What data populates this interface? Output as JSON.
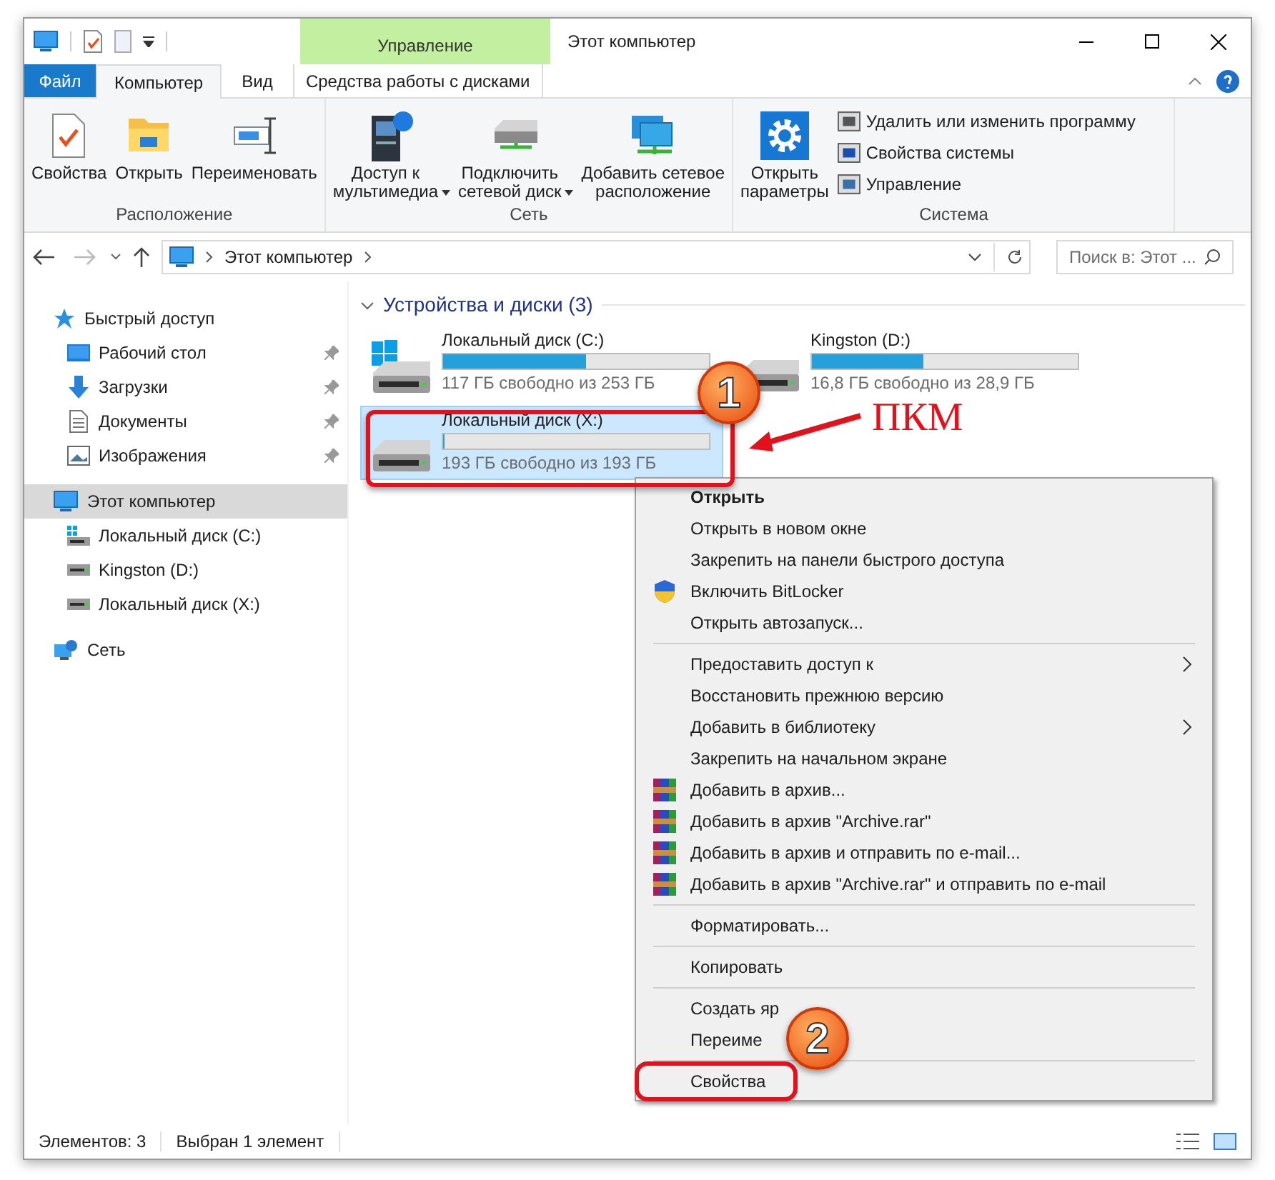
{
  "title_bar": {
    "context_tab": "Управление",
    "title": "Этот компьютер"
  },
  "ribbon_tabs": [
    {
      "label": "Файл",
      "kind": "file",
      "selected": false
    },
    {
      "label": "Компьютер",
      "kind": "tab",
      "selected": true
    },
    {
      "label": "Вид",
      "kind": "tab",
      "selected": false
    },
    {
      "label": "Средства работы с дисками",
      "kind": "context",
      "selected": false
    }
  ],
  "ribbon_groups": [
    {
      "label": "Расположение",
      "buttons": [
        {
          "label": "Свойства"
        },
        {
          "label": "Открыть"
        },
        {
          "label": "Переименовать"
        }
      ]
    },
    {
      "label": "Сеть",
      "buttons": [
        {
          "label": "Доступ к\nмультимедиа",
          "dropdown": true
        },
        {
          "label": "Подключить\nсетевой диск",
          "dropdown": true
        },
        {
          "label": "Добавить сетевое\nрасположение",
          "dropdown": false
        }
      ]
    },
    {
      "label": "Система",
      "buttons": [
        {
          "label": "Открыть\nпараметры",
          "dropdown": false
        }
      ],
      "small_buttons": [
        "Удалить или изменить программу",
        "Свойства системы",
        "Управление"
      ]
    }
  ],
  "address_bar": {
    "path": "Этот компьютер",
    "search_placeholder": "Поиск в: Этот ..."
  },
  "navigation": [
    {
      "label": "Быстрый доступ",
      "selected": false,
      "children": [
        {
          "label": "Рабочий стол",
          "pinned": true
        },
        {
          "label": "Загрузки",
          "pinned": true
        },
        {
          "label": "Документы",
          "pinned": true
        },
        {
          "label": "Изображения",
          "pinned": true
        }
      ]
    },
    {
      "label": "Этот компьютер",
      "selected": true,
      "children": [
        {
          "label": "Локальный диск (C:)",
          "pinned": false
        },
        {
          "label": "Kingston (D:)",
          "pinned": false
        },
        {
          "label": "Локальный диск (X:)",
          "pinned": false
        }
      ]
    },
    {
      "label": "Сеть",
      "selected": false
    }
  ],
  "section": {
    "title": "Устройства и диски (3)"
  },
  "drives": [
    {
      "name": "Локальный диск (C:)",
      "free": "117 ГБ свободно из 253 ГБ",
      "level": 0.54,
      "system": true,
      "selected": false
    },
    {
      "name": "Kingston (D:)",
      "free": "16,8 ГБ свободно из 28,9 ГБ",
      "level": 0.42,
      "system": false,
      "selected": false
    },
    {
      "name": "Локальный диск (X:)",
      "free": "193 ГБ свободно из 193 ГБ",
      "level": 0,
      "system": false,
      "selected": true
    }
  ],
  "context_menu": [
    [
      {
        "label": "Открыть",
        "bold": true
      },
      {
        "label": "Открыть в новом окне"
      },
      {
        "label": "Закрепить на панели быстрого доступа"
      },
      {
        "label": "Включить BitLocker",
        "kind": "shield"
      },
      {
        "label": "Открыть автозапуск..."
      }
    ],
    [
      {
        "label": "Предоставить доступ к",
        "submenu": true
      },
      {
        "label": "Восстановить прежнюю версию"
      },
      {
        "label": "Добавить в библиотеку",
        "submenu": true
      },
      {
        "label": "Закрепить на начальном экране"
      },
      {
        "label": "Добавить в архив...",
        "kind": "archive"
      },
      {
        "label": "Добавить в архив \"Archive.rar\"",
        "kind": "archive"
      },
      {
        "label": "Добавить в архив и отправить по e-mail...",
        "kind": "archive"
      },
      {
        "label": "Добавить в архив \"Archive.rar\" и отправить по e-mail",
        "kind": "archive"
      }
    ],
    [
      {
        "label": "Форматировать..."
      }
    ],
    [
      {
        "label": "Копировать"
      }
    ],
    [
      {
        "label": "Создать яр"
      },
      {
        "label": "Переиме"
      }
    ],
    [
      {
        "label": "Свойства",
        "highlighted": true
      }
    ]
  ],
  "status_bar": {
    "items": "Элементов: 3",
    "selection": "Выбран 1 элемент"
  },
  "annotations": {
    "step_1": "1",
    "step_2": "2",
    "caption": "ПКМ"
  }
}
